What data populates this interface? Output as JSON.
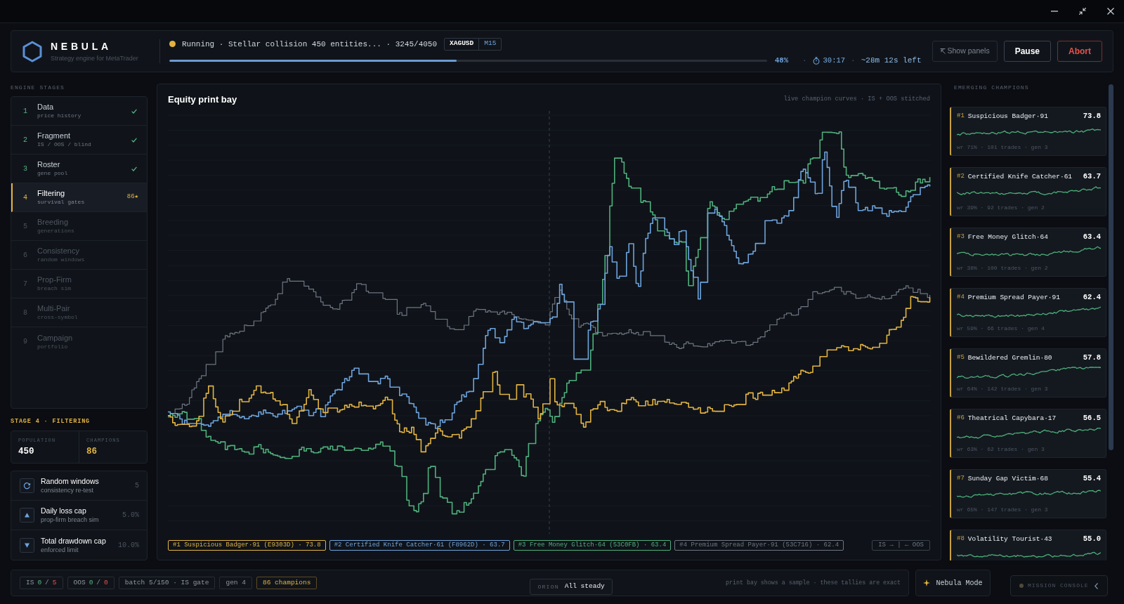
{
  "header": {
    "app_name": "NEBULA",
    "tagline": "Strategy engine for MetaTrader",
    "run": {
      "running": true,
      "text": "Running · Stellar collision 450 entities... · 3245/4050",
      "symbol": "XAGUSD",
      "timeframe": "M15"
    },
    "progress": {
      "level": 0.48,
      "percent": "48%",
      "timing": [
        {
          "kind": "separator",
          "text": "·"
        },
        {
          "kind": "timer",
          "text": "30:17"
        },
        {
          "kind": "separator",
          "text": "·"
        },
        {
          "kind": "remaining",
          "text": "~28m 12s left"
        }
      ]
    },
    "buttons": [
      {
        "label": "Show panels",
        "kind": "ghost"
      },
      {
        "label": "Pause",
        "kind": "primary"
      },
      {
        "label": "Abort",
        "kind": "danger"
      }
    ]
  },
  "sidebar": {
    "title": "ENGINE STAGES",
    "stages": [
      {
        "number": "1",
        "name": "Data",
        "detail": "price history",
        "done": true,
        "selected": false
      },
      {
        "number": "2",
        "name": "Fragment",
        "detail": "IS / OOS / blind",
        "done": true,
        "selected": false
      },
      {
        "number": "3",
        "name": "Roster",
        "detail": "gene pool",
        "done": true,
        "selected": false
      },
      {
        "number": "4",
        "name": "Filtering",
        "detail": "survival gates",
        "done": false,
        "selected": true,
        "badge": "86★"
      },
      {
        "number": "5",
        "name": "Breeding",
        "detail": "generations",
        "done": false,
        "selected": false
      },
      {
        "number": "6",
        "name": "Consistency",
        "detail": "random windows",
        "done": false,
        "selected": false
      },
      {
        "number": "7",
        "name": "Prop-Firm",
        "detail": "breach sim",
        "done": false,
        "selected": false
      },
      {
        "number": "8",
        "name": "Multi-Pair",
        "detail": "cross-symbol",
        "done": false,
        "selected": false
      },
      {
        "number": "9",
        "name": "Campaign",
        "detail": "portfolio",
        "done": false,
        "selected": false
      }
    ],
    "stage_heading": "STAGE 4 · FILTERING",
    "stats": [
      {
        "label": "POPULATION",
        "value": "450",
        "kind": "plain"
      },
      {
        "label": "CHAMPIONS",
        "value": "86",
        "kind": "highlight"
      }
    ],
    "gates": [
      {
        "kind": "retest",
        "name": "Random windows",
        "detail": "consistency re-test",
        "value": "5"
      },
      {
        "kind": "daily_cap",
        "name": "Daily loss cap",
        "detail": "prop-firm breach sim",
        "value": "5.0%"
      },
      {
        "kind": "drawdown_cap",
        "name": "Total drawdown cap",
        "detail": "enforced limit",
        "value": "10.0%"
      }
    ]
  },
  "chart": {
    "title": "Equity print bay",
    "caption": "live champion curves · IS + OOS stitched",
    "legend": [
      {
        "label": "#1 Suspicious Badger·91 (E9303D) · 73.8",
        "color": "#e3b341"
      },
      {
        "label": "#2 Certified Knife Catcher·61 (F8962D) · 63.7",
        "color": "#6ea3dc"
      },
      {
        "label": "#3 Free Money Glitch·64 (53C0FB) · 63.4",
        "color": "#4fb07c"
      },
      {
        "label": "#4 Premium Spread Payer·91 (53C716) · 62.4",
        "color": "#6e7681"
      }
    ],
    "split_label": "IS → | ← OOS"
  },
  "champions": {
    "title": "EMERGING CHAMPIONS",
    "items": [
      {
        "rank": "#1",
        "name": "Suspicious Badger·91",
        "score": "73.8",
        "stats": "wr 71% · 101 trades · gen 3"
      },
      {
        "rank": "#2",
        "name": "Certified Knife Catcher·61",
        "score": "63.7",
        "stats": "wr 39% · 92 trades · gen 2"
      },
      {
        "rank": "#3",
        "name": "Free Money Glitch·64",
        "score": "63.4",
        "stats": "wr 38% · 100 trades · gen 2"
      },
      {
        "rank": "#4",
        "name": "Premium Spread Payer·91",
        "score": "62.4",
        "stats": "wr 59% · 66 trades · gen 4"
      },
      {
        "rank": "#5",
        "name": "Bewildered Gremlin·80",
        "score": "57.8",
        "stats": "wr 64% · 142 trades · gen 3"
      },
      {
        "rank": "#6",
        "name": "Theatrical Capybara·17",
        "score": "56.5",
        "stats": "wr 63% · 62 trades · gen 3"
      },
      {
        "rank": "#7",
        "name": "Sunday Gap Victim·68",
        "score": "55.4",
        "stats": "wr 65% · 147 trades · gen 3"
      },
      {
        "rank": "#8",
        "name": "Volatility Tourist·43",
        "score": "55.0"
      }
    ]
  },
  "footer": {
    "tallies": [
      {
        "kind": "ratio",
        "label": "IS",
        "passed": "0",
        "separator": "/",
        "failed": "5"
      },
      {
        "kind": "ratio",
        "label": "OOS",
        "passed": "0",
        "separator": "/",
        "failed": "0"
      },
      {
        "kind": "plain",
        "text": "batch 5/150 · IS gate"
      },
      {
        "kind": "plain",
        "text": "gen 4"
      },
      {
        "kind": "highlight",
        "text": "86 champions"
      }
    ],
    "orion": {
      "label": "ORION",
      "message": "All steady"
    },
    "note": "print bay shows a sample · these tallies are exact",
    "mode_button": "Nebula Mode",
    "console_button": "MISSION CONSOLE"
  }
}
